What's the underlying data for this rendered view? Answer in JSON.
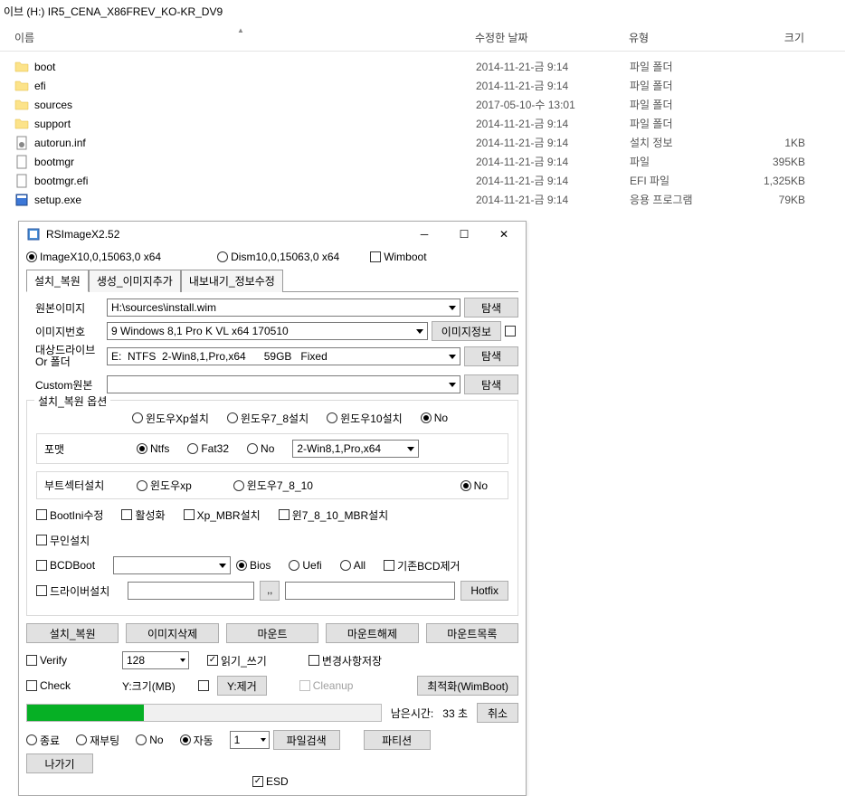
{
  "explorer": {
    "path": "이브 (H:) IR5_CENA_X86FREV_KO-KR_DV9",
    "columns": {
      "name": "이름",
      "date": "수정한 날짜",
      "type": "유형",
      "size": "크기"
    },
    "rows": [
      {
        "icon": "folder",
        "name": "boot",
        "date": "2014-11-21-금 9:14",
        "type": "파일 폴더",
        "size": ""
      },
      {
        "icon": "folder",
        "name": "efi",
        "date": "2014-11-21-금 9:14",
        "type": "파일 폴더",
        "size": ""
      },
      {
        "icon": "folder",
        "name": "sources",
        "date": "2017-05-10-수 13:01",
        "type": "파일 폴더",
        "size": ""
      },
      {
        "icon": "folder",
        "name": "support",
        "date": "2014-11-21-금 9:14",
        "type": "파일 폴더",
        "size": ""
      },
      {
        "icon": "inf",
        "name": "autorun.inf",
        "date": "2014-11-21-금 9:14",
        "type": "설치 정보",
        "size": "1KB"
      },
      {
        "icon": "file",
        "name": "bootmgr",
        "date": "2014-11-21-금 9:14",
        "type": "파일",
        "size": "395KB"
      },
      {
        "icon": "file",
        "name": "bootmgr.efi",
        "date": "2014-11-21-금 9:14",
        "type": "EFI 파일",
        "size": "1,325KB"
      },
      {
        "icon": "exe",
        "name": "setup.exe",
        "date": "2014-11-21-금 9:14",
        "type": "응용 프로그램",
        "size": "79KB"
      }
    ]
  },
  "app": {
    "title": "RSImageX2.52",
    "topRadios": {
      "imagex": "ImageX10,0,15063,0 x64",
      "dism": "Dism10,0,15063,0 x64",
      "wimboot": "Wimboot"
    },
    "tabs": [
      "설치_복원",
      "생성_이미지추가",
      "내보내기_정보수정"
    ],
    "form": {
      "sourceImageLabel": "원본이미지",
      "sourceImageValue": "H:\\sources\\install.wim",
      "browse": "탐색",
      "imageIndexLabel": "이미지번호",
      "imageIndexValue": "9  Windows 8,1 Pro K VL x64 170510",
      "imageInfo": "이미지정보",
      "targetDriveLabel": "대상드라이브\nOr 폴더",
      "targetDriveValue": "E:  NTFS  2-Win8,1,Pro,x64      59GB   Fixed",
      "customSourceLabel": "Custom원본"
    },
    "options": {
      "legend": "설치_복원 옵션",
      "installRadios": {
        "xp": "윈도우Xp설치",
        "w78": "윈도우7_8설치",
        "w10": "윈도우10설치",
        "no": "No"
      },
      "formatLabel": "포맷",
      "formatRadios": {
        "ntfs": "Ntfs",
        "fat32": "Fat32",
        "no": "No"
      },
      "formatTarget": "2-Win8,1,Pro,x64",
      "bootSectorLabel": "부트섹터설치",
      "bootSectorRadios": {
        "xp": "윈도우xp",
        "w7810": "윈도우7_8_10",
        "no": "No"
      },
      "checks": {
        "bootini": "BootIni수정",
        "activate": "활성화",
        "xpmbr": "Xp_MBR설치",
        "w7810mbr": "윈7_8_10_MBR설치",
        "unattended": "무인설치",
        "bcdboot": "BCDBoot",
        "existingbcd": "기존BCD제거",
        "driver": "드라이버설치"
      },
      "bcdRadios": {
        "bios": "Bios",
        "uefi": "Uefi",
        "all": "All"
      },
      "hotfix": "Hotfix",
      "browseDots": ",,"
    },
    "actions": {
      "install": "설치_복원",
      "deleteImage": "이미지삭제",
      "mount": "마운트",
      "unmount": "마운트해제",
      "mountList": "마운트목록"
    },
    "verify": {
      "verify": "Verify",
      "check": "Check",
      "sizeValue": "128",
      "sizeLabel": "Y:크기(MB)",
      "readWrite": "읽기_쓰기",
      "yRemove": "Y:제거",
      "saveChanges": "변경사항저장",
      "cleanup": "Cleanup",
      "optimize": "최적화(WimBoot)"
    },
    "progress": {
      "percent": 33,
      "remainLabel": "남은시간:",
      "remainValue": "33 초",
      "cancel": "취소"
    },
    "bottom": {
      "shutdown": "종료",
      "reboot": "재부팅",
      "no": "No",
      "auto": "자동",
      "countValue": "1",
      "fileSearch": "파일검색",
      "partition": "파티션",
      "exit": "나가기",
      "esd": "ESD"
    }
  }
}
